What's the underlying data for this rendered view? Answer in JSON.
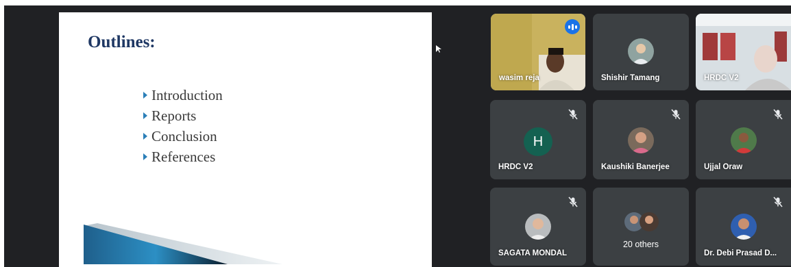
{
  "slide": {
    "title": "Outlines:",
    "bullets": [
      "Introduction",
      "Reports",
      "Conclusion",
      "References"
    ]
  },
  "participants": [
    {
      "name": "wasim reja",
      "state": "speaking",
      "video": true
    },
    {
      "name": "Shishir Tamang",
      "state": "muted",
      "video": false
    },
    {
      "name": "HRDC V2",
      "state": "unmuted",
      "video": true
    },
    {
      "name": "HRDC V2",
      "state": "muted",
      "video": false,
      "initial": "H"
    },
    {
      "name": "Kaushiki Banerjee",
      "state": "muted",
      "video": false
    },
    {
      "name": "Ujjal Oraw",
      "state": "muted",
      "video": false
    },
    {
      "name": "SAGATA MONDAL",
      "state": "muted",
      "video": false
    },
    {
      "label": "20 others"
    },
    {
      "name": "Dr. Debi Prasad D...",
      "state": "muted",
      "video": false
    }
  ],
  "colors": {
    "background": "#202124",
    "tile": "#3c4043",
    "active_outline": "#8ab4f8",
    "speaking": "#1a73e8",
    "slide_title": "#1f3864",
    "initial_avatar": "#146151"
  },
  "icons": {
    "speaking": "audio-level-icon",
    "muted": "mic-off-icon",
    "bullet": "triangle-bullet-icon"
  }
}
